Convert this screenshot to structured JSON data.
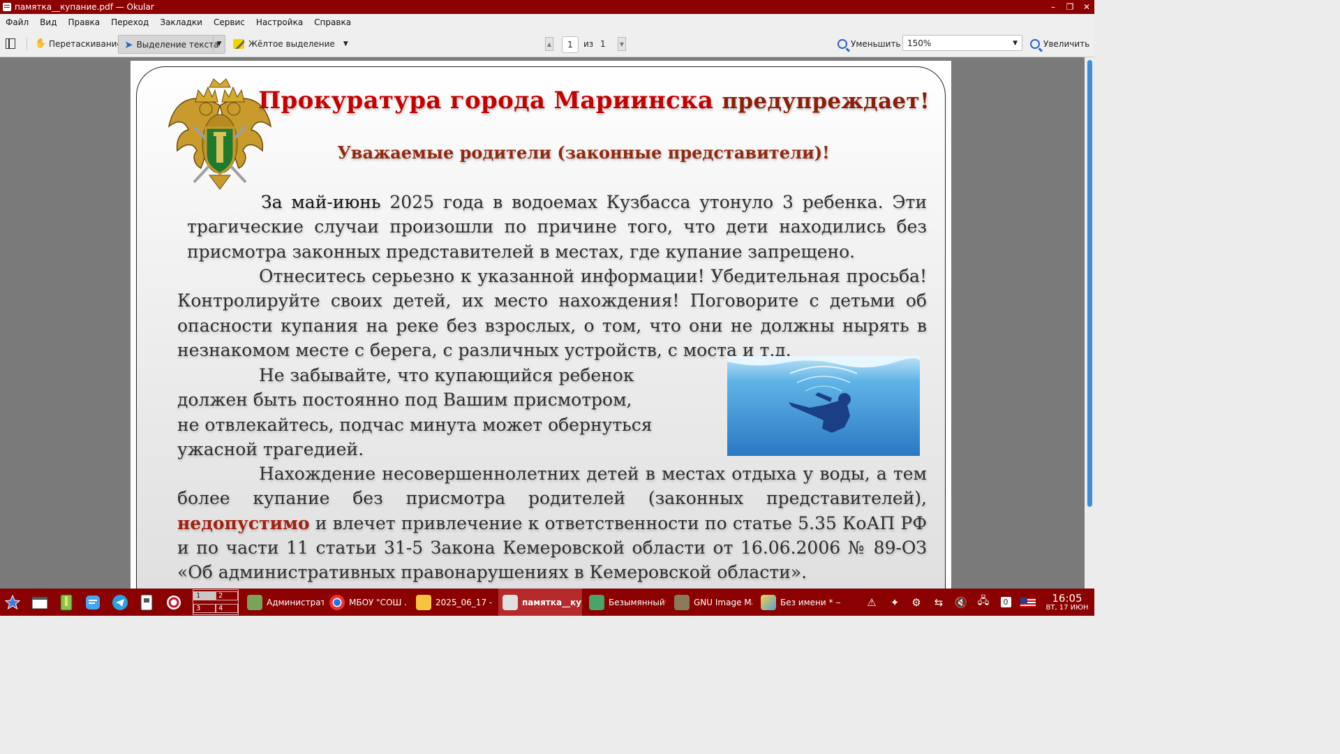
{
  "window": {
    "title": "памятка__купание.pdf — Okular",
    "controls": [
      "–",
      "❐",
      "✕"
    ]
  },
  "menu": [
    "Файл",
    "Вид",
    "Правка",
    "Переход",
    "Закладки",
    "Сервис",
    "Настройка",
    "Справка"
  ],
  "toolbar": {
    "browse_label": "Перетаскивание",
    "select_label": "Выделение текста",
    "highlight_label": "Жёлтое выделение",
    "page_current": "1",
    "page_of": "из",
    "page_total": "1",
    "zoom_out_label": "Уменьшить",
    "zoom_value": "150%",
    "zoom_in_label": "Увеличить"
  },
  "document": {
    "headline_red": "Прокуратура  города Мариинска",
    "headline_rest": "предупреждает!",
    "subheadline": "Уважаемые родители (законные представители)!",
    "p1_lead": "За май-июнь",
    "p1_rest": "2025 года в водоемах Кузбасса утонуло 3 ребенка. Эти трагические случаи произошли по причине того, что дети находились без присмотра законных представителей в местах, где купание запрещено.",
    "p2": "Отнеситесь серьезно к указанной информации! Убедительная просьба! Контролируйте своих детей, их место нахождения! Поговорите с детьми об опасности купания на реке без взрослых, о том, что они не должны нырять в незнакомом месте с берега, с различных устройств, с моста и т.д.",
    "p3_lines": [
      "Не забывайте,  что  купающийся  ребенок",
      "должен быть постоянно  под   Вашим  присмотром,",
      "не отвлекайтесь, подчас минута может обернуться",
      "ужасной трагедией."
    ],
    "p4_start": "Нахождение несовершеннолетних детей в местах отдыха у воды, а тем более купание без присмотра родителей (законных представителей),",
    "p4_warn": "недопустимо",
    "p4_end": "и влечет привлечение к ответственности по статье 5.35 КоАП РФ и по части 11 статьи 31-5 Закона Кемеровской области от 16.06.2006 № 89-ОЗ «Об административных правонарушениях в Кемеровской области»."
  },
  "taskbar": {
    "pager": [
      "1",
      "2",
      "3",
      "4"
    ],
    "tasks": [
      {
        "label": "Администрат...",
        "icon": "admin-icon"
      },
      {
        "label": "МБОУ \"СОШ ...",
        "icon": "chrome-icon"
      },
      {
        "label": "2025_06_17 - ...",
        "icon": "folder-icon"
      },
      {
        "label": "памятка__куп...",
        "icon": "okular-icon"
      },
      {
        "label": "Безымянный* ...",
        "icon": "image-editor-icon"
      },
      {
        "label": "GNU Image Ma...",
        "icon": "gimp-icon"
      },
      {
        "label": "Без имени * — ...",
        "icon": "text-editor-icon"
      }
    ],
    "notification_count": "0",
    "time": "16:05",
    "date": "ВТ, 17 ИЮН"
  },
  "colors": {
    "titlebar": "#8b0000",
    "headline_red": "#c60000",
    "headline_dark": "#8a1f0a",
    "accent_blue": "#2a64c8"
  }
}
